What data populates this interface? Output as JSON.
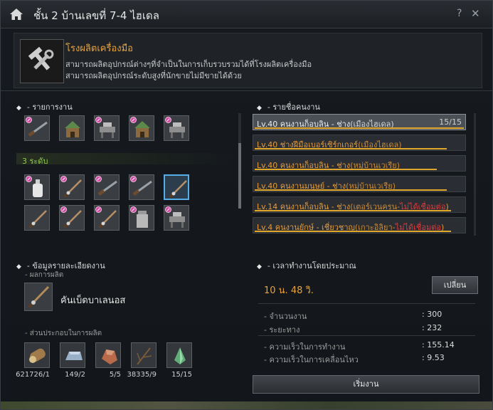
{
  "window": {
    "title": "ชั้น 2 บ้านเลขที่ 7-4 ไฮเดล",
    "help": "?",
    "close": "✕"
  },
  "factory": {
    "name": "โรงผลิตเครื่องมือ",
    "desc1": "สามารถผลิตอุปกรณ์ต่างๆที่จำเป็นในการเก็บรวบรวมได้ที่โรงผลิตเครื่องมือ",
    "desc2": "สามารถผลิตอุปกรณ์ระดับสูงที่นักขายไม่มีขายได้ด้วย"
  },
  "tasks": {
    "title": "- รายการงาน",
    "rank_label": "3 ระดับ",
    "row1": [
      {
        "icon": "rifle-icon",
        "locked": true
      },
      {
        "icon": "house-icon",
        "locked": false
      },
      {
        "icon": "workbench-icon",
        "locked": true
      },
      {
        "icon": "house-icon",
        "locked": true
      },
      {
        "icon": "workbench-icon",
        "locked": true
      }
    ],
    "row2": [
      {
        "icon": "flask-icon",
        "locked": true
      },
      {
        "icon": "fishing-rod-icon",
        "locked": true
      },
      {
        "icon": "rifle-icon",
        "locked": true
      },
      {
        "icon": "rifle-icon",
        "locked": true
      },
      {
        "icon": "fishing-rod-icon",
        "locked": false,
        "selected": true
      }
    ],
    "row3": [
      {
        "icon": "fishing-rod-icon",
        "locked": false
      },
      {
        "icon": "fishing-rod-icon",
        "locked": true
      },
      {
        "icon": "fishing-rod-icon",
        "locked": true
      },
      {
        "icon": "jar-icon",
        "locked": true
      },
      {
        "icon": "workbench-icon",
        "locked": true
      }
    ]
  },
  "workers": {
    "title": "- รายชื่อคนงาน",
    "list": [
      {
        "lv": "Lv.40",
        "name": " คนงานก็อบลิน - ช่าง",
        "loc": "(เมืองไฮเดล)",
        "status": "",
        "count": "15/15",
        "stamina": 1.0,
        "selected": true
      },
      {
        "lv": "Lv.40",
        "name": " ช่างฝีมือเบอร์เซิร์กเกอร์",
        "loc": "(เมืองไฮเดล)",
        "status": "",
        "count": "",
        "stamina": 0.92,
        "selected": false
      },
      {
        "lv": "Lv.40",
        "name": " คนงานก็อบลิน - ช่าง",
        "loc": "(หมู่บ้านเวเรีย)",
        "status": "",
        "count": "",
        "stamina": 0.87,
        "selected": false
      },
      {
        "lv": "Lv.40",
        "name": " คนงานมนุษย์ - ช่าง",
        "loc": "(หมู่บ้านเวเรีย)",
        "status": "",
        "count": "",
        "stamina": 0.92,
        "selected": false
      },
      {
        "lv": "Lv.14",
        "name": " คนงานก็อบลิน - ช่าง",
        "loc": "(เตอร์เวนครูน-",
        "status": "ไม่ได้เชื่อมต่อ",
        "status_suffix": ")",
        "count": "",
        "stamina": 0.94,
        "selected": false
      },
      {
        "lv": "Lv.4",
        "name": " คนงานยักษ์ - เชี่ยวชาญ",
        "loc": "(เกาะอิลิยา-",
        "status": "ไม่ได้เชื่อมต่อ",
        "status_suffix": ")",
        "count": "",
        "stamina": 0.94,
        "selected": false
      }
    ]
  },
  "details": {
    "title": "- ข้อมูลรายละเอียดงาน",
    "product_label": "- ผลการผลิต",
    "product_name": "คันเบ็ดบาเลนอส",
    "materials_label": "- ส่วนประกอบในการผลิต",
    "materials": [
      {
        "icon": "log-icon",
        "count": "621726/1"
      },
      {
        "icon": "ingot-icon",
        "count": "149/2"
      },
      {
        "icon": "ore-icon",
        "count": "5/5"
      },
      {
        "icon": "branch-icon",
        "count": "38335/9"
      },
      {
        "icon": "crystal-icon",
        "count": "15/15"
      }
    ]
  },
  "time": {
    "title": "- เวลาทำงานโดยประมาณ",
    "value": "10 น. 48 วิ.",
    "change_button": "เปลี่ยน",
    "stats": [
      {
        "label": "- จำนวนงาน",
        "value": ": 300"
      },
      {
        "label": "- ระยะทาง",
        "value": ": 232"
      },
      {
        "label": "- ความเร็วในการทำงาน",
        "value": ": 155.14"
      },
      {
        "label": "- ความเร็วในการเคลื่อนไหว",
        "value": ": 9.53"
      }
    ],
    "start_button": "เริ่มงาน"
  }
}
